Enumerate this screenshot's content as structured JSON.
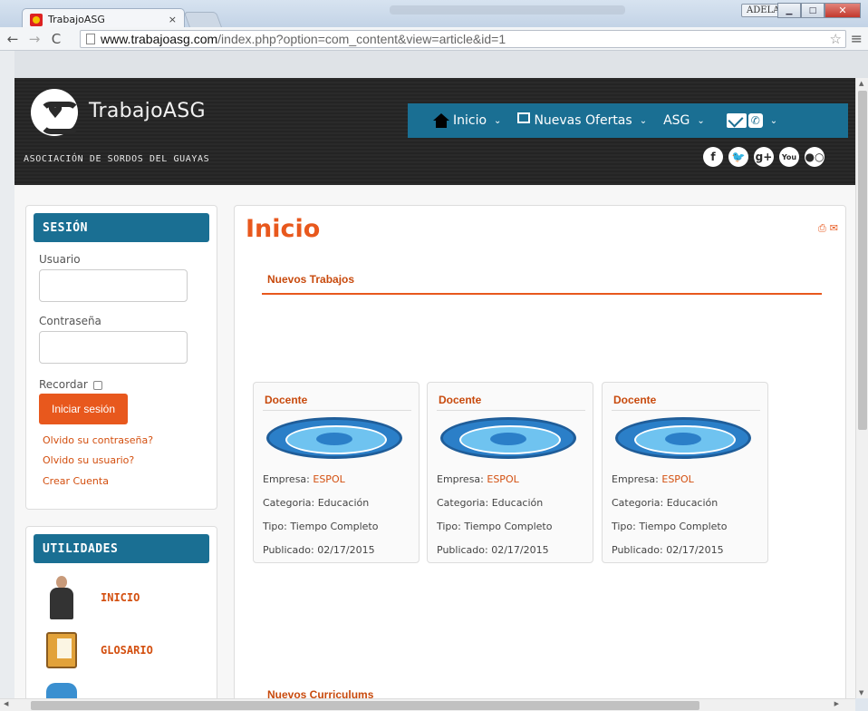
{
  "browser": {
    "tab_title": "TrabajoASG",
    "tab_close": "×",
    "window_user": "ADELA",
    "url_host": "www.trabajoasg.com",
    "url_path": "/index.php?option=com_content&view=article&id=1"
  },
  "header": {
    "site_name": "TrabajoASG",
    "subtitle": "ASOCIACIÓN DE SORDOS DEL GUAYAS",
    "nav": [
      {
        "label": "Inicio",
        "icon": "home-icon"
      },
      {
        "label": "Nuevas Ofertas",
        "icon": "news-icon"
      },
      {
        "label": "ASG",
        "icon": ""
      }
    ],
    "social": [
      "f",
      "t",
      "g+",
      "You",
      "flickr"
    ]
  },
  "sidebar": {
    "session_title": "SESIÓN",
    "user_label": "Usuario",
    "password_label": "Contraseña",
    "remember_label": "Recordar",
    "login_button": "Iniciar sesión",
    "links": [
      "Olvido su contraseña?",
      "Olvido su usuario?",
      "Crear Cuenta"
    ],
    "utils_title": "UTILIDADES",
    "utils": [
      {
        "label": "INICIO",
        "icon": "person-icon"
      },
      {
        "label": "GLOSARIO",
        "icon": "agenda-icon"
      },
      {
        "label": "",
        "icon": "mailbox-icon"
      }
    ]
  },
  "main": {
    "title": "Inicio",
    "section_jobs": "Nuevos Trabajos",
    "section_cv": "Nuevos Curriculums",
    "jobs": [
      {
        "title": "Docente",
        "empresa_label": "Empresa:",
        "empresa": "ESPOL",
        "categoria": "Categoria: Educación",
        "tipo": "Tipo: Tiempo Completo",
        "publicado": "Publicado: 02/17/2015"
      },
      {
        "title": "Docente",
        "empresa_label": "Empresa:",
        "empresa": "ESPOL",
        "categoria": "Categoria: Educación",
        "tipo": "Tipo: Tiempo Completo",
        "publicado": "Publicado: 02/17/2015"
      },
      {
        "title": "Docente",
        "empresa_label": "Empresa:",
        "empresa": "ESPOL",
        "categoria": "Categoria: Educación",
        "tipo": "Tipo: Tiempo Completo",
        "publicado": "Publicado: 02/17/2015"
      }
    ]
  },
  "colors": {
    "accent": "#e8581d",
    "nav": "#1a6f93",
    "header": "#2a2a2a"
  }
}
